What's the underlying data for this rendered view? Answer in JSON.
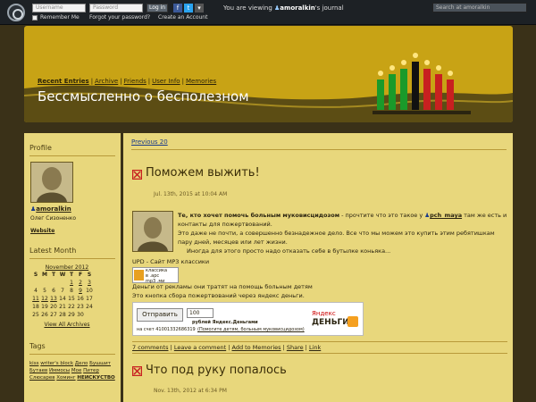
{
  "topbar": {
    "username_placeholder": "Username",
    "password_placeholder": "Password",
    "login_label": "Log in",
    "remember_label": "Remember Me",
    "forgot_label": "Forgot your password?",
    "create_label": "Create an Account",
    "viewing_prefix": "You are viewing",
    "viewing_user": "amoralkin",
    "viewing_suffix": "'s journal",
    "search_placeholder": "Search at amoralkin"
  },
  "header": {
    "nav": [
      "Recent Entries",
      "Archive",
      "Friends",
      "User Info",
      "Memories"
    ],
    "title": "Бессмысленно о бесполезном"
  },
  "sidebar": {
    "profile_heading": "Profile",
    "username": "amoralkin",
    "fullname": "Олег Сизоненко",
    "website_label": "Website",
    "latest_heading": "Latest Month",
    "month": "November 2012",
    "weekdays": [
      "S",
      "M",
      "T",
      "W",
      "T",
      "F",
      "S"
    ],
    "weeks": [
      [
        "",
        "",
        "",
        "",
        "1",
        "2",
        "3"
      ],
      [
        "4",
        "5",
        "6",
        "7",
        "8",
        "9",
        "10"
      ],
      [
        "11",
        "12",
        "13",
        "14",
        "15",
        "16",
        "17"
      ],
      [
        "18",
        "19",
        "20",
        "21",
        "22",
        "23",
        "24"
      ],
      [
        "25",
        "26",
        "27",
        "28",
        "29",
        "30",
        ""
      ]
    ],
    "view_all": "View All Archives",
    "tags_heading": "Tags",
    "tags": [
      "kiss",
      "writer's block",
      "Дело",
      "Бушшит",
      "Бутаев",
      "Иммосы",
      "Мое",
      "Питер",
      "Слюсарев",
      "Хоминг",
      "НЕИСКУСТВО"
    ]
  },
  "main": {
    "previous": "Previous 20",
    "post1": {
      "subject": "Поможем выжить!",
      "date": "Jul. 13th, 2015 at 10:04 AM",
      "bold_lead": "Те, кто хочет помочь больным муковисцидозом",
      "text1": " - прочтите что это такое у ",
      "user": "pch_maya",
      "text1b": " там же есть и контакты для пожертвований.",
      "line2": "Это даже не почти, а совершенно безнадежное дело. Все что мы можем это купить этим ребятишкам пару дней, месяцев или лет жизни.",
      "line3": "Иногда для этого просто надо отказать себе в бутылке коньяка...",
      "upd": "UPD - Сайт MP3 классики",
      "banner_l1": "классика",
      "banner_l2": "в .арс",
      "banner_l3": "mp3 .ми",
      "line4": "Деньги от рекламы они тратят на помощь больным детям",
      "line5": "Это кнопка сбора пожертвований через яндекс деньги.",
      "ya_button": "Отправить",
      "ya_amount": "100",
      "ya_text1": "рублей Яндекс.Деньгами",
      "ya_text2": "на счет 41001332686319",
      "ya_text3": "(Помогите детям, больным муковисцидозом)",
      "ya_logo1": "Яндекс",
      "ya_logo2": "ДЕНЬГИ",
      "footer": [
        "7 comments",
        "Leave a comment",
        "Add to Memories",
        "Share",
        "Link"
      ]
    },
    "post2": {
      "subject": "Что под руку попалось",
      "date": "Nov. 13th, 2012 at 6:34 PM"
    }
  },
  "colors": {
    "topbar": "#1d2125",
    "header_gold": "#c8a315",
    "content": "#e8d77c",
    "link_blue": "#1a3a8a"
  }
}
